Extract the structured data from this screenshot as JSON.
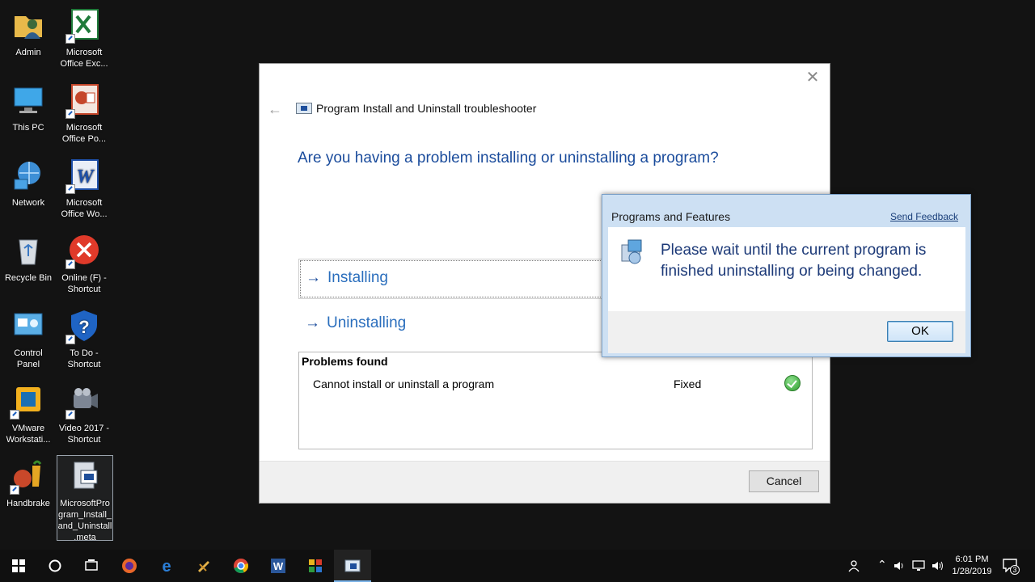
{
  "desktop": {
    "icons": [
      {
        "label": "Admin"
      },
      {
        "label": "Microsoft\nOffice Exc..."
      },
      {
        "label": "This PC"
      },
      {
        "label": "Microsoft\nOffice Po..."
      },
      {
        "label": "Network"
      },
      {
        "label": "Microsoft\nOffice Wo..."
      },
      {
        "label": "Recycle Bin"
      },
      {
        "label": "Online (F) -\nShortcut"
      },
      {
        "label": "Control\nPanel"
      },
      {
        "label": "To Do -\nShortcut"
      },
      {
        "label": "VMware\nWorkstati..."
      },
      {
        "label": "Video 2017 -\nShortcut"
      },
      {
        "label": "Handbrake"
      },
      {
        "label": "MicrosoftPro\ngram_Install_\nand_Uninstall\n.meta"
      }
    ]
  },
  "troubleshooter": {
    "title": "Program Install and Uninstall troubleshooter",
    "question": "Are you having a problem installing or uninstalling a program?",
    "options": [
      {
        "label": "Installing"
      },
      {
        "label": "Uninstalling"
      }
    ],
    "problems": {
      "header": "Problems found",
      "item_name": "Cannot install or uninstall a program",
      "item_status": "Fixed"
    },
    "cancel_label": "Cancel"
  },
  "dialog": {
    "title": "Programs and Features",
    "feedback_link": "Send Feedback",
    "message": "Please wait until the current program is finished uninstalling or being changed.",
    "ok_label": "OK"
  },
  "taskbar": {
    "time": "6:01 PM",
    "date": "1/28/2019",
    "notification_count": "3"
  },
  "colors": {
    "desktop_bg": "#131313",
    "accent_blue": "#1b4c9c",
    "link_blue": "#2a6ebd",
    "dialog_frame": "#cde0f3"
  }
}
